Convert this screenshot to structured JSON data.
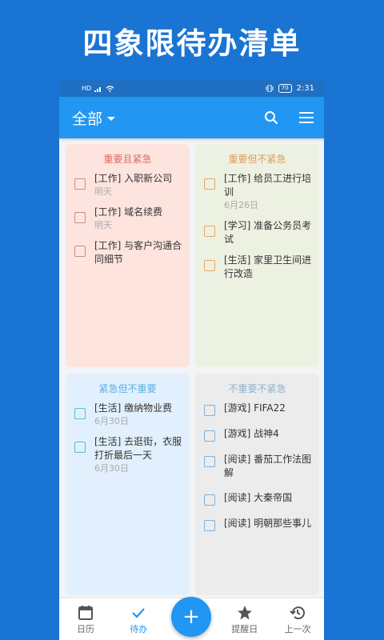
{
  "promo_title": "四象限待办清单",
  "statusbar": {
    "left": "HD",
    "battery": "70",
    "time": "2:31"
  },
  "appbar": {
    "filter_label": "全部"
  },
  "colors": {
    "accent": "#2196f3",
    "red": "#e06a5c",
    "orange": "#e8a766",
    "cyan": "#5fb8cf",
    "blue_title": "#5bb0e0",
    "gray_title": "#999999"
  },
  "quadrants": [
    {
      "title": "重要且紧急",
      "tasks": [
        {
          "text": "[工作] 入职新公司",
          "date": "明天"
        },
        {
          "text": "[工作] 域名续费",
          "date": "明天"
        },
        {
          "text": "[工作] 与客户沟通合同细节",
          "date": ""
        }
      ]
    },
    {
      "title": "重要但不紧急",
      "tasks": [
        {
          "text": "[工作] 给员工进行培训",
          "date": "6月26日"
        },
        {
          "text": "[学习] 准备公务员考试",
          "date": ""
        },
        {
          "text": "[生活] 家里卫生间进行改造",
          "date": ""
        }
      ]
    },
    {
      "title": "紧急但不重要",
      "tasks": [
        {
          "text": "[生活] 缴纳物业费",
          "date": "6月30日"
        },
        {
          "text": "[生活] 去逛街，衣服打折最后一天",
          "date": "6月30日"
        }
      ]
    },
    {
      "title": "不重要不紧急",
      "tasks": [
        {
          "text": "[游戏] FIFA22",
          "date": ""
        },
        {
          "text": "[游戏] 战神4",
          "date": ""
        },
        {
          "text": "[阅读] 番茄工作法图解",
          "date": ""
        },
        {
          "text": "[阅读] 大秦帝国",
          "date": ""
        },
        {
          "text": "[阅读] 明朝那些事儿",
          "date": ""
        }
      ]
    }
  ],
  "bottom_nav": {
    "calendar": "日历",
    "todo": "待办",
    "fab": "+",
    "reminder": "提醒日",
    "last": "上一次"
  }
}
